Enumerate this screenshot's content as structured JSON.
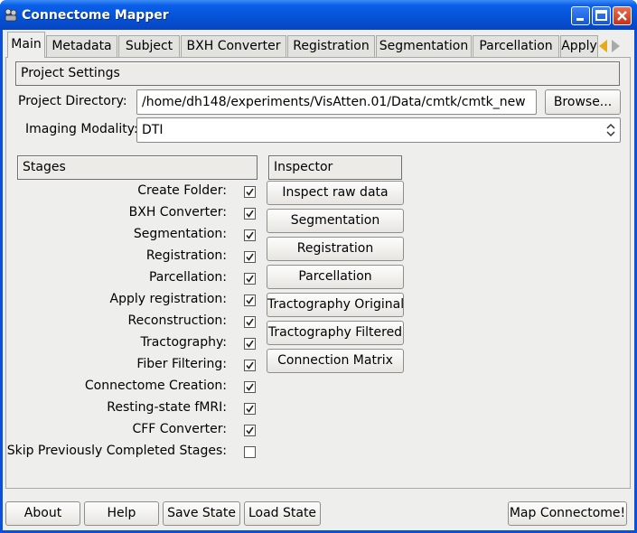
{
  "window": {
    "title": "Connectome Mapper"
  },
  "tabs": [
    {
      "label": "Main"
    },
    {
      "label": "Metadata"
    },
    {
      "label": "Subject"
    },
    {
      "label": "BXH Converter"
    },
    {
      "label": "Registration"
    },
    {
      "label": "Segmentation"
    },
    {
      "label": "Parcellation"
    },
    {
      "label": "Apply"
    }
  ],
  "project_settings": {
    "header": "Project Settings",
    "directory_label": "Project Directory:",
    "directory_value": "/home/dh148/experiments/VisAtten.01/Data/cmtk/cmtk_new",
    "browse_label": "Browse...",
    "modality_label": "Imaging Modality:",
    "modality_value": "DTI"
  },
  "stages": {
    "header": "Stages",
    "items": [
      {
        "label": "Create Folder:",
        "checked": true
      },
      {
        "label": "BXH Converter:",
        "checked": true
      },
      {
        "label": "Segmentation:",
        "checked": true
      },
      {
        "label": "Registration:",
        "checked": true
      },
      {
        "label": "Parcellation:",
        "checked": true
      },
      {
        "label": "Apply registration:",
        "checked": true
      },
      {
        "label": "Reconstruction:",
        "checked": true
      },
      {
        "label": "Tractography:",
        "checked": true
      },
      {
        "label": "Fiber Filtering:",
        "checked": true
      },
      {
        "label": "Connectome Creation:",
        "checked": true
      },
      {
        "label": "Resting-state fMRI:",
        "checked": true
      },
      {
        "label": "CFF Converter:",
        "checked": true
      },
      {
        "label": "Skip Previously Completed Stages:",
        "checked": false
      }
    ]
  },
  "inspector": {
    "header": "Inspector",
    "buttons": [
      {
        "label": "Inspect raw data"
      },
      {
        "label": "Segmentation"
      },
      {
        "label": "Registration"
      },
      {
        "label": "Parcellation"
      },
      {
        "label": "Tractography Original"
      },
      {
        "label": "Tractography Filtered"
      },
      {
        "label": "Connection Matrix"
      }
    ]
  },
  "footer": {
    "about": "About",
    "help": "Help",
    "save_state": "Save State",
    "load_state": "Load State",
    "map": "Map Connectome!"
  },
  "colors": {
    "titlebar": "#0552d6",
    "client_bg": "#eeeeec",
    "close_button": "#c3321a",
    "tab_scroll_active": "#e6a919"
  }
}
